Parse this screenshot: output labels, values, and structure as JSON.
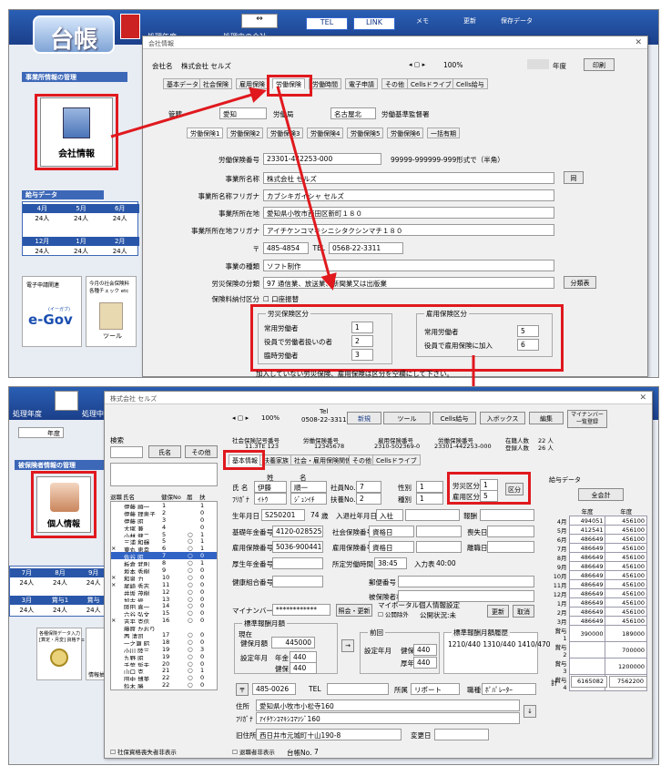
{
  "top": {
    "app_title": "台帳",
    "menu1": "処理年度",
    "menu2": "処理中の会社",
    "btn_tel": "TEL",
    "btn_link": "LINK",
    "btn_memo": "メモ",
    "btn_update": "更新",
    "btn_save": "保存データ",
    "sidebar_header": "事業所情報の管理",
    "company_btn": "会社情報",
    "salary_header": "給与データ",
    "months_top": [
      "4月",
      "5月",
      "6月"
    ],
    "counts_top": [
      "24人",
      "24人",
      "24人"
    ],
    "months_bot": [
      "12月",
      "1月",
      "2月"
    ],
    "counts_bot": [
      "24人",
      "24人",
      "24人"
    ],
    "egov_label": "電子申請関連",
    "egov_logo": "e-Gov",
    "egov_small": "(イーガブ)",
    "tool_label": "今月の社会保険料\n各種チェック etc",
    "tool_text": "ツール",
    "dlg_title": "会社情報",
    "company_label": "会社名",
    "company_name": "株式会社 セルズ",
    "zoom": "100%",
    "year_label": "年度",
    "print_btn": "印刷",
    "tabs": [
      "基本データ",
      "社会保険",
      "雇用保険",
      "労働保険",
      "労働時間",
      "電子申請",
      "その他",
      "Cellsドライブ",
      "Cells給与"
    ],
    "row1_label": "管轄",
    "row1_pref": "愛知",
    "row1_bureau": "労働局",
    "row1_office": "名古屋北",
    "row1_office2": "労働基準監督署",
    "subtabs": [
      "労働保険1",
      "労働保険2",
      "労働保険3",
      "労働保険4",
      "労働保険5",
      "労働保険6",
      "一括有期"
    ],
    "f_no_label": "労働保険番号",
    "f_no": "23301-442253-000",
    "f_no_hint": "99999-999999-999形式で（半角）",
    "f_name_label": "事業所名称",
    "f_name": "株式会社 セルズ",
    "same_btn": "同",
    "f_kana_label": "事業所名称フリガナ",
    "f_kana": "カブシキガイシャ セルズ",
    "f_addr_label": "事業所所在地",
    "f_addr": "愛知県小牧市西田区新町１８０",
    "f_addrkana_label": "事業所所在地フリガナ",
    "f_addrkana": "アイチケンコマキシニシタクシンマチ１８０",
    "f_zip_label": "〒",
    "f_zip": "485-4854",
    "f_tel_label": "TEL",
    "f_tel": "0568-22-3311",
    "f_type_label": "事業の種類",
    "f_type": "ソフト制作",
    "f_class_label": "労災保険の分類",
    "f_class": "97 通信業、放送業、新聞業又は出版業",
    "class_btn": "分類表",
    "f_pay_label": "保険料納付区分",
    "f_pay_chk": "口座振替",
    "g1_title": "労災保険区分",
    "g1_r1": "常用労働者",
    "g1_v1": "1",
    "g1_r2": "役員で労働者扱いの者",
    "g1_v2": "2",
    "g1_r3": "臨時労働者",
    "g1_v3": "3",
    "g2_title": "雇用保険区分",
    "g2_r1": "常用労働者",
    "g2_v1": "5",
    "g2_r2": "役員で雇用保険に加入",
    "g2_v2": "6",
    "note": "加入していない労災保険、雇用保険は区分を空欄にして下さい。"
  },
  "bottom": {
    "menu1": "処理年度",
    "menu2": "処理中",
    "year": "年度",
    "sidebar_header": "被保険者情報の管理",
    "person_btn": "個人情報",
    "months_top": [
      "7月",
      "8月",
      "9月"
    ],
    "counts_top": [
      "24人",
      "24人",
      "24人"
    ],
    "months_bot": [
      "3月",
      "賞与1",
      "賞与"
    ],
    "counts_bot": [
      "24人",
      "24人",
      "24人"
    ],
    "tool1": "各種保険データ入力\n[算定・月変] 資格チェック",
    "tool2": "情報抽出",
    "dlg_title": "株式会社 セルズ",
    "search_label": "検索",
    "btn_name": "氏名",
    "btn_other": "その他",
    "list_headers": [
      "退職",
      "氏名",
      "健保No",
      "届",
      "扶"
    ],
    "list_rows": [
      [
        "",
        "伊藤 順一",
        "1",
        "",
        "1"
      ],
      [
        "",
        "伊藤 理恵子",
        "2",
        "",
        "0"
      ],
      [
        "",
        "伊藤 昭",
        "3",
        "",
        "0"
      ],
      [
        "",
        "大塚 兼",
        "4",
        "",
        "0"
      ],
      [
        "",
        "小林 健二",
        "5",
        "○",
        "1"
      ],
      [
        "",
        "三浦 和輝",
        "5",
        "○",
        "1"
      ],
      [
        "×",
        "東丸 恵幸",
        "6",
        "○",
        "1"
      ],
      [
        "",
        "佐谷 昭",
        "7",
        "○",
        "0"
      ],
      [
        "",
        "板倉 武則",
        "8",
        "○",
        "1"
      ],
      [
        "",
        "坂本 秀樹",
        "9",
        "○",
        "0"
      ],
      [
        "×",
        "和泉 力",
        "10",
        "○",
        "0"
      ],
      [
        "×",
        "尾崎 秀志",
        "11",
        "○",
        "0"
      ],
      [
        "",
        "井坂 茂樹",
        "12",
        "○",
        "0"
      ],
      [
        "",
        "加古 修",
        "13",
        "○",
        "0"
      ],
      [
        "",
        "阪田 真一",
        "14",
        "○",
        "0"
      ],
      [
        "",
        "六谷 弘文",
        "15",
        "○",
        "0"
      ],
      [
        "×",
        "吉平 克信",
        "16",
        "○",
        "0"
      ],
      [
        "",
        "藤原 かおり",
        "",
        "",
        ""
      ],
      [
        "",
        "西 清司",
        "17",
        "○",
        "0"
      ],
      [
        "",
        "一之瀬 昭",
        "18",
        "○",
        "0"
      ],
      [
        "",
        "小川 陸三",
        "19",
        "○",
        "3"
      ],
      [
        "",
        "九野 昭",
        "19",
        "○",
        "0"
      ],
      [
        "",
        "千葉 哲夫",
        "20",
        "○",
        "0"
      ],
      [
        "",
        "山口 克",
        "21",
        "○",
        "1"
      ],
      [
        "",
        "田中 博美",
        "22",
        "○",
        "0"
      ],
      [
        "",
        "鈴木 勝",
        "22",
        "○",
        "0"
      ]
    ],
    "chk_list": "社保資格喪失者非表示",
    "zoom": "100%",
    "tel_label": "Tel",
    "tel": "0508-22-3311",
    "btn_new": "新規",
    "btn_tool": "ツール",
    "btn_cells": "Cells給与",
    "btn_inbox": "入ボックス",
    "btn_edit": "編集",
    "btn_mynum": "マイナンバー\n一覧登録",
    "info1_label": "社会保険記号番号",
    "info1": "11.3TE 123",
    "info2_label": "労働保険番号",
    "info2": "12345678",
    "info3_label": "雇用保険番号",
    "info3": "2310-502369-0",
    "info4_label": "労働保険番号",
    "info4": "23301-442253-000",
    "info5_label": "在籍人数",
    "info5": "22 人",
    "info6_label": "登録人数",
    "info6": "26 人",
    "tabs": [
      "基本情報",
      "扶養家族",
      "社会・雇用保険関係",
      "その他",
      "Cellsドライブ"
    ],
    "sei_label": "姓",
    "mei_label": "名",
    "name_label": "氏 名",
    "sei": "伊藤",
    "mei": "順一",
    "kana_label": "ﾌﾘｶﾞﾅ",
    "sei_kana": "ｲﾄｳ",
    "mei_kana": "ｼﾞｭﾝｲﾁ",
    "shaho_no_label": "社員No.",
    "shaho_no": "7",
    "koyo_no_label": "扶養No.",
    "koyo_no": "2",
    "sex_label": "性別",
    "sex": "1",
    "kubun_label": "種別",
    "kubun": "1",
    "rosai_label": "労災区分",
    "rosai": "1",
    "koyo_kbn_label": "雇用区分",
    "koyo_kbn": "5",
    "kbn_btn": "区分",
    "birth_label": "生年月日",
    "birth": "S250201",
    "age": "74",
    "age_label": "歳",
    "join_label": "入退社年月日",
    "join_sel": "入社",
    "retire_label": "報酬",
    "kenpo_no_label": "基礎年金番号",
    "kenpo_no": "4120-028525",
    "shaho_label": "社会保険番号",
    "shaho": "資格日",
    "koyo_label": "雇用保険番号",
    "koyo": "5036-900441-7",
    "koyo2_label": "雇用保険番号",
    "koyo2": "資格日",
    "loss1": "喪失日",
    "loss2": "離職日",
    "kosei_label": "厚生年金番号",
    "kyotsu_label": "所定労働時間",
    "kyotsu": "38:45",
    "nyuryoku_label": "入力表",
    "nyuryoku": "40:00",
    "kenpo2_label": "健康組合番号",
    "todokede_label": "郵便番号",
    "hoken_label": "被保険者状況",
    "mynum_label": "マイナンバー",
    "mynum": "************",
    "btn_confirm": "照会・更新",
    "mynum_note": "マイポータル個人情報設定",
    "chk_public": "公開除外",
    "public_status": "公開状況:未",
    "btn_update": "更新",
    "btn_cancel": "取消",
    "std_title": "標準報酬月額",
    "std_now": "現在",
    "std_kenpo_label": "健保月額",
    "std_kenpo": "445000",
    "std_set_label": "設定年月",
    "std_nenkin_label": "年金",
    "std_nenkin": "440",
    "std_kenpo2_label": "健保",
    "std_kenpo2": "440",
    "prev_title": "前回",
    "prev_set_label": "設定年月",
    "prev_kenpo_label": "健保",
    "prev_kenpo": "440",
    "prev_nenkin_label": "厚年",
    "prev_nenkin": "440",
    "hist_title": "標準報酬月額履歴",
    "hist": "1210/440 1310/440 1410/470",
    "zip_label": "〒",
    "zip": "485-0026",
    "tel2_label": "TEL",
    "shozoku_label": "所属",
    "shozoku": "リポート",
    "shokumu_label": "職種",
    "shokumu": "ﾎﾟﾊﾟﾚｰﾀｰ",
    "addr_label": "住所",
    "addr": "愛知県小牧市小松寺160",
    "addr_kana_label": "ﾌﾘｶﾞﾅ",
    "addr_kana": "ｱｲﾁｹﾝｺﾏｷｼｺﾏﾂｼﾞ160",
    "old_addr_label": "旧住所",
    "old_addr": "西日井市元城町十山190-8",
    "change_label": "変更日",
    "chk_bottom": "退職者非表示",
    "bottom_no_label": "台帳No.",
    "bottom_no": "7",
    "side_title": "給与データ",
    "btn_all": "全会計",
    "side_headers": [
      "",
      "年度",
      "年度"
    ],
    "side_rows": [
      [
        "4月",
        "494051",
        "456100"
      ],
      [
        "5月",
        "412541",
        "456100"
      ],
      [
        "6月",
        "486649",
        "456100"
      ],
      [
        "7月",
        "486649",
        "456100"
      ],
      [
        "8月",
        "486649",
        "456100"
      ],
      [
        "9月",
        "486649",
        "456100"
      ],
      [
        "10月",
        "486649",
        "456100"
      ],
      [
        "11月",
        "486649",
        "456100"
      ],
      [
        "12月",
        "486649",
        "456100"
      ],
      [
        "1月",
        "486649",
        "456100"
      ],
      [
        "2月",
        "486649",
        "456100"
      ],
      [
        "3月",
        "486649",
        "456100"
      ],
      [
        "賞与1",
        "390000",
        "189000"
      ],
      [
        "賞与2",
        "",
        "700000"
      ],
      [
        "賞与3",
        "",
        "1200000"
      ],
      [
        "賞与4",
        "",
        ""
      ]
    ],
    "side_total_label": "計",
    "side_total1": "6165082",
    "side_total2": "7562200"
  }
}
